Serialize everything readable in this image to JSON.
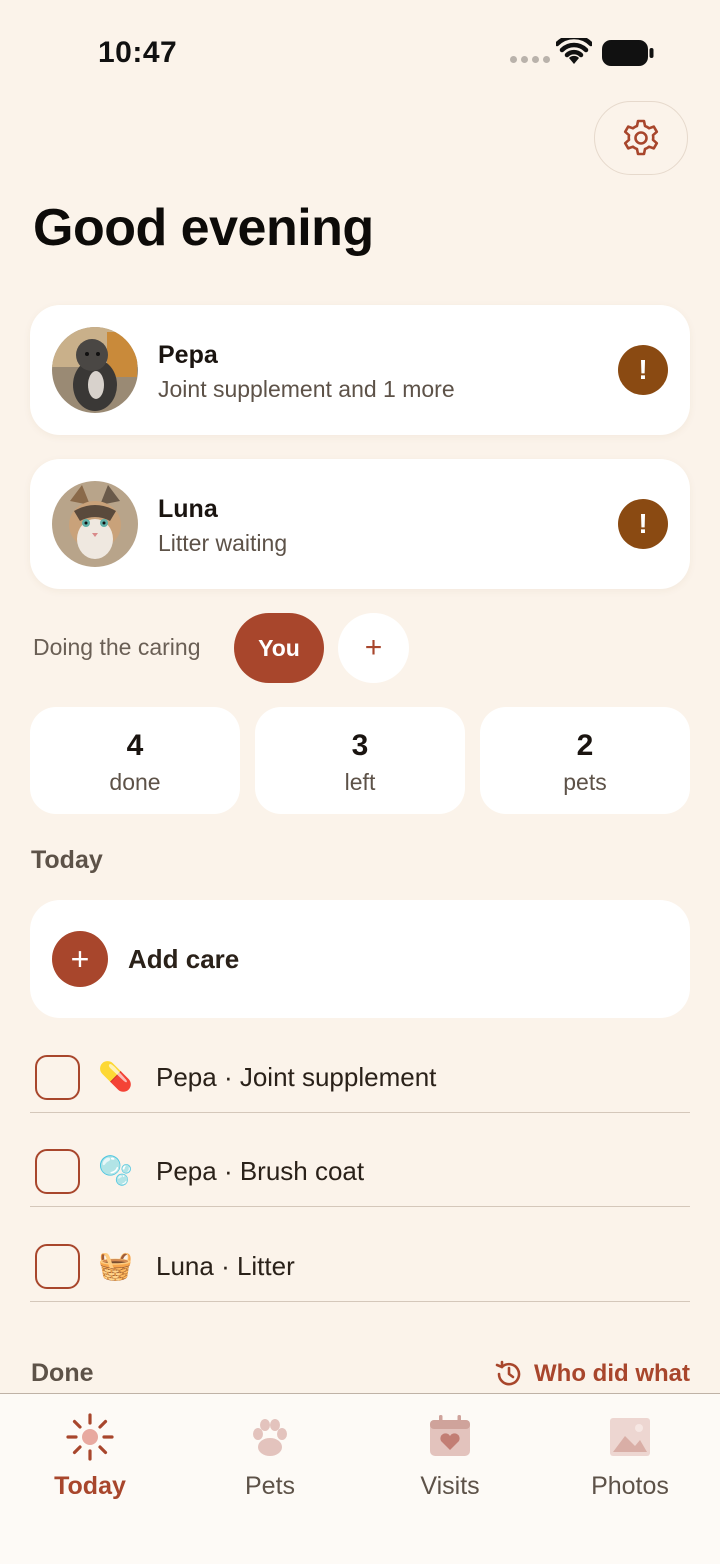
{
  "status_bar": {
    "time": "10:47"
  },
  "header": {
    "greeting": "Good evening"
  },
  "pets": [
    {
      "name": "Pepa",
      "subtitle": "Joint supplement and 1 more",
      "alert": "!"
    },
    {
      "name": "Luna",
      "subtitle": "Litter waiting",
      "alert": "!"
    }
  ],
  "caring": {
    "label": "Doing the caring",
    "active_person": "You",
    "add_symbol": "+"
  },
  "stats": [
    {
      "value": "4",
      "label": "done"
    },
    {
      "value": "3",
      "label": "left"
    },
    {
      "value": "2",
      "label": "pets"
    }
  ],
  "today": {
    "heading": "Today",
    "add_care_symbol": "+",
    "add_care_label": "Add care",
    "tasks": [
      {
        "emoji": "💊",
        "label": "Pepa · Joint supplement",
        "icon": "pill-icon"
      },
      {
        "emoji": "🫧",
        "label": "Pepa · Brush coat",
        "icon": "bubbles-icon"
      },
      {
        "emoji": "🧺",
        "label": "Luna · Litter",
        "icon": "basket-icon"
      }
    ]
  },
  "done": {
    "heading": "Done",
    "who_did_what": "Who did what"
  },
  "tabs": [
    {
      "label": "Today",
      "icon": "sun-icon",
      "active": true
    },
    {
      "label": "Pets",
      "icon": "paw-icon",
      "active": false
    },
    {
      "label": "Visits",
      "icon": "calendar-heart-icon",
      "active": false
    },
    {
      "label": "Photos",
      "icon": "photo-icon",
      "active": false
    }
  ],
  "colors": {
    "accent": "#a8462c",
    "alert": "#8a4a12",
    "background": "#fbf3ea"
  }
}
